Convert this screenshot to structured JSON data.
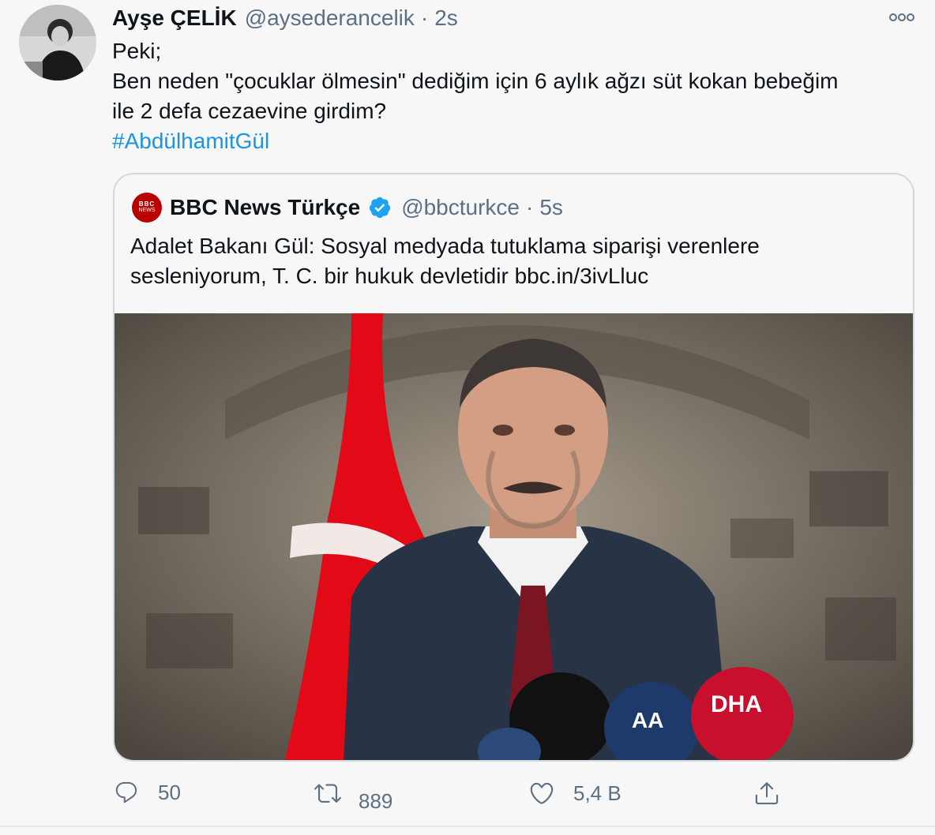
{
  "tweet": {
    "author_name": "Ayşe ÇELİK",
    "author_handle": "@aysederancelik",
    "separator": "·",
    "time": "2s",
    "text_lines": [
      "Peki;",
      "Ben neden \"çocuklar ölmesin\" dediğim için 6 aylık ağzı süt kokan bebeğim",
      "ile 2 defa cezaevine girdim?"
    ],
    "hashtag": "#AbdülhamitGül"
  },
  "quote": {
    "avatar_text_top": "BBC",
    "avatar_text_bottom": "NEWS",
    "author_name": "BBC News Türkçe",
    "author_handle": "@bbcturkce",
    "separator": "·",
    "time": "5s",
    "text_lines": [
      "Adalet Bakanı Gül: Sosyal medyada tutuklama siparişi verenlere",
      "sesleniyorum, T. C. bir hukuk devletidir bbc.in/3ivLluc"
    ],
    "image_mic_labels": [
      "DHA",
      "AA"
    ]
  },
  "actions": {
    "reply_count": "50",
    "retweet_count": "889",
    "like_count": "5,4 B"
  },
  "icons": {
    "more": "more-icon",
    "verified": "verified-badge-icon",
    "reply": "reply-icon",
    "retweet": "retweet-icon",
    "like": "like-icon",
    "share": "share-icon"
  },
  "colors": {
    "link": "#1b95e0",
    "secondary_text": "#5b7083",
    "verified": "#1da1f2",
    "bbc_red": "#b80000",
    "flag_red": "#e30a17"
  }
}
